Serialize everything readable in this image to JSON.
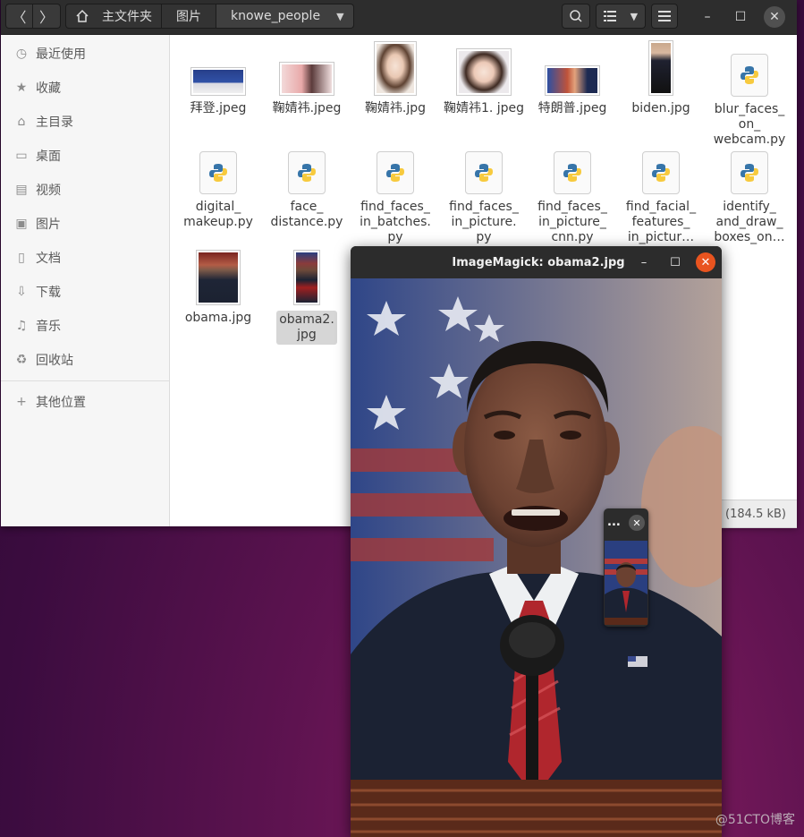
{
  "files": {
    "breadcrumbs": [
      "主文件夹",
      "图片",
      "knowe_people"
    ],
    "sidebar": [
      {
        "icon": "clock-icon",
        "label": "最近使用"
      },
      {
        "icon": "star-icon",
        "label": "收藏"
      },
      {
        "icon": "home-icon",
        "label": "主目录"
      },
      {
        "icon": "desktop-icon",
        "label": "桌面"
      },
      {
        "icon": "video-icon",
        "label": "视频"
      },
      {
        "icon": "picture-icon",
        "label": "图片"
      },
      {
        "icon": "document-icon",
        "label": "文档"
      },
      {
        "icon": "download-icon",
        "label": "下载"
      },
      {
        "icon": "music-icon",
        "label": "音乐"
      },
      {
        "icon": "trash-icon",
        "label": "回收站"
      },
      {
        "icon": "plus-icon",
        "label": "其他位置"
      }
    ],
    "items": [
      {
        "name": "拜登.jpeg",
        "kind": "image"
      },
      {
        "name": "鞠婧祎.jpeg",
        "kind": "image"
      },
      {
        "name": "鞠婧祎.jpg",
        "kind": "image"
      },
      {
        "name": "鞠婧祎1.\njpeg",
        "kind": "image"
      },
      {
        "name": "特朗普.jpeg",
        "kind": "image"
      },
      {
        "name": "biden.jpg",
        "kind": "image"
      },
      {
        "name": "blur_faces_\non_\nwebcam.py",
        "kind": "python"
      },
      {
        "name": "digital_\nmakeup.py",
        "kind": "python"
      },
      {
        "name": "face_\ndistance.py",
        "kind": "python"
      },
      {
        "name": "find_faces_\nin_batches.\npy",
        "kind": "python"
      },
      {
        "name": "find_faces_\nin_picture.\npy",
        "kind": "python"
      },
      {
        "name": "find_faces_\nin_picture_\ncnn.py",
        "kind": "python"
      },
      {
        "name": "find_facial_\nfeatures_\nin_pictur…",
        "kind": "python"
      },
      {
        "name": "identify_\nand_draw_\nboxes_on…",
        "kind": "python"
      },
      {
        "name": "obama.jpg",
        "kind": "image"
      },
      {
        "name": "obama2.\njpg",
        "kind": "image",
        "selected": true
      }
    ],
    "status": "(184.5 kB)"
  },
  "viewer": {
    "title": "ImageMagick: obama2.jpg",
    "mini_title": "..."
  },
  "watermark": "@51CTO博客"
}
